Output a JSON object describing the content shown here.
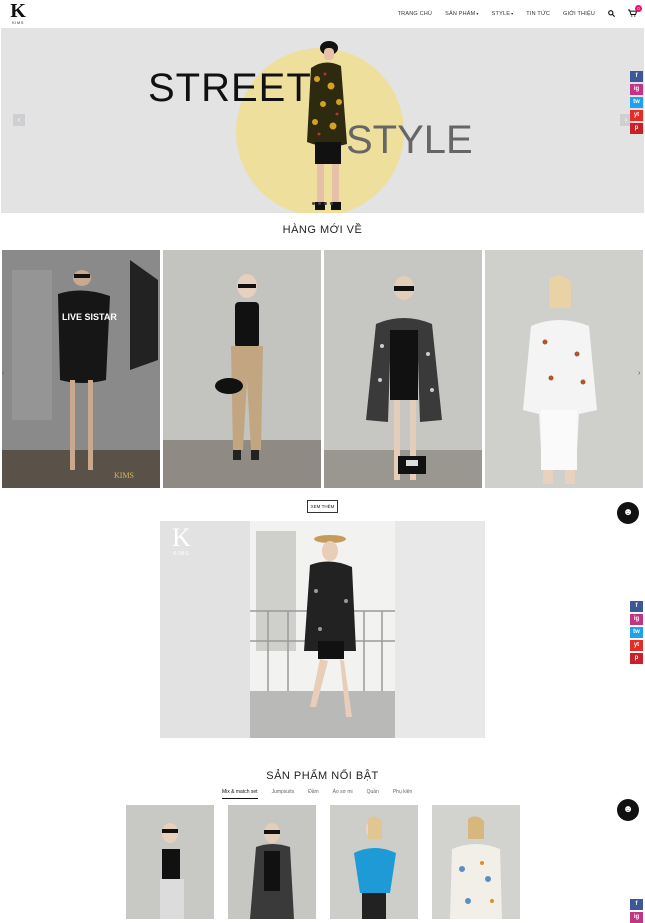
{
  "brand": {
    "logo_letter": "K",
    "logo_text": "KIMS",
    "accent": "#e4156e"
  },
  "nav": {
    "items": [
      "TRANG CHỦ",
      "SẢN PHẨM",
      "STYLE",
      "TIN TỨC",
      "GIỚI THIỆU"
    ],
    "cart_count": "0"
  },
  "hero": {
    "word1": "STREET",
    "word2": "STYLE",
    "prev_arrow": "‹",
    "next_arrow": "›",
    "slides": 4,
    "circle_color": "#efdf9d"
  },
  "social": [
    "f",
    "ig",
    "tw",
    "yt",
    "p"
  ],
  "new_arrivals": {
    "title": "HÀNG MỚI VỀ",
    "more_label": "XEM THÊM",
    "products": [
      {
        "name": "product-1",
        "watermark": "KIMS"
      },
      {
        "name": "product-2"
      },
      {
        "name": "product-3"
      },
      {
        "name": "product-4"
      }
    ]
  },
  "lookbook": {
    "logo_letter": "K",
    "logo_text": "KIMS"
  },
  "featured": {
    "title": "SẢN PHẨM NỔI BẬT",
    "tabs": [
      "Mix & match set",
      "Jumpsuits",
      "Đầm",
      "Áo sơ mi",
      "Quần",
      "Phụ kiện"
    ],
    "active_tab": 0
  },
  "chat_icon": "☻"
}
